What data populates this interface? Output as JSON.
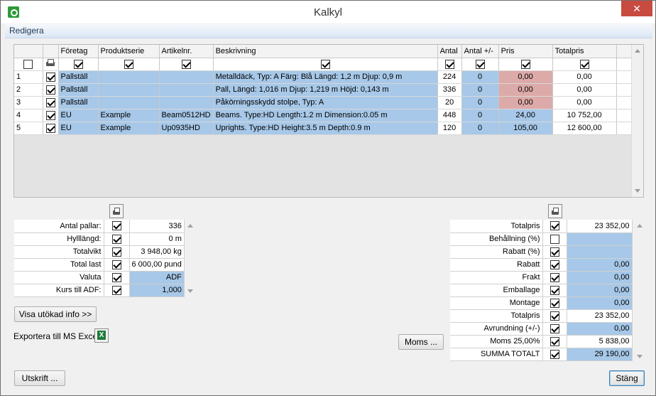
{
  "window": {
    "title": "Kalkyl",
    "close_label": "✕"
  },
  "menu": {
    "items": [
      "Redigera"
    ]
  },
  "grid": {
    "columns": [
      "",
      "",
      "Företag",
      "Produktserie",
      "Artikelnr.",
      "Beskrivning",
      "Antal",
      "Antal +/-",
      "Pris",
      "Totalpris"
    ],
    "rows": [
      {
        "nr": "1",
        "foretag": "Pallställ",
        "produktserie": "",
        "artikelnr": "",
        "beskrivning": "Metalldäck, Typ: A Färg: Blå Längd: 1,2 m Djup: 0,9 m",
        "antal": "224",
        "antal_diff": "0",
        "pris": "0,00",
        "totalpris": "0,00"
      },
      {
        "nr": "2",
        "foretag": "Pallställ",
        "produktserie": "",
        "artikelnr": "",
        "beskrivning": "Pall, Längd: 1,016 m Djup: 1,219 m Höjd: 0,143 m",
        "antal": "336",
        "antal_diff": "0",
        "pris": "0,00",
        "totalpris": "0,00"
      },
      {
        "nr": "3",
        "foretag": "Pallställ",
        "produktserie": "",
        "artikelnr": "",
        "beskrivning": "Påkörningsskydd stolpe, Typ: A",
        "antal": "20",
        "antal_diff": "0",
        "pris": "0,00",
        "totalpris": "0,00"
      },
      {
        "nr": "4",
        "foretag": "EU",
        "produktserie": "Example",
        "artikelnr": "Beam0512HD",
        "beskrivning": "Beams. Type:HD Length:1.2 m Dimension:0.05 m",
        "antal": "448",
        "antal_diff": "0",
        "pris": "24,00",
        "totalpris": "10 752,00"
      },
      {
        "nr": "5",
        "foretag": "EU",
        "produktserie": "Example",
        "artikelnr": "Up0935HD",
        "beskrivning": "Uprights. Type:HD Height:3.5 m Depth:0.9 m",
        "antal": "120",
        "antal_diff": "0",
        "pris": "105,00",
        "totalpris": "12 600,00"
      }
    ]
  },
  "left_summary": [
    {
      "label": "Antal pallar:",
      "value": "336"
    },
    {
      "label": "Hylllängd:",
      "value": "0 m"
    },
    {
      "label": "Totalvikt",
      "value": "3 948,00 kg"
    },
    {
      "label": "Total last",
      "value": "6 000,00 pund"
    },
    {
      "label": "Valuta",
      "value": "ADF"
    },
    {
      "label": "Kurs till ADF:",
      "value": "1,000"
    }
  ],
  "right_summary": [
    {
      "label": "Totalpris",
      "value": "23 352,00",
      "checked": true
    },
    {
      "label": "Behållning (%)",
      "value": "",
      "checked": false
    },
    {
      "label": "Rabatt (%)",
      "value": "",
      "checked": true
    },
    {
      "label": "Rabatt",
      "value": "0,00",
      "checked": true
    },
    {
      "label": "Frakt",
      "value": "0,00",
      "checked": true
    },
    {
      "label": "Emballage",
      "value": "0,00",
      "checked": true
    },
    {
      "label": "Montage",
      "value": "0,00",
      "checked": true
    },
    {
      "label": "Totalpris",
      "value": "23 352,00",
      "checked": true
    },
    {
      "label": "Avrundning (+/-)",
      "value": "0,00",
      "checked": true
    },
    {
      "label": "Moms 25,00%",
      "value": "5 838,00",
      "checked": true
    },
    {
      "label": "SUMMA TOTALT",
      "value": "29 190,00",
      "checked": true
    }
  ],
  "buttons": {
    "show_extended": "Visa utökad info >>",
    "export_label": "Exportera till MS Excel",
    "moms": "Moms ...",
    "print": "Utskrift ...",
    "close": "Stäng"
  },
  "icons": {
    "app": "app-icon",
    "printer": "printer-icon",
    "excel": "excel-icon"
  },
  "colors": {
    "editable_blue": "#a7c8e8",
    "price_pink": "#dcaaa8",
    "close_red": "#c74b3f"
  }
}
